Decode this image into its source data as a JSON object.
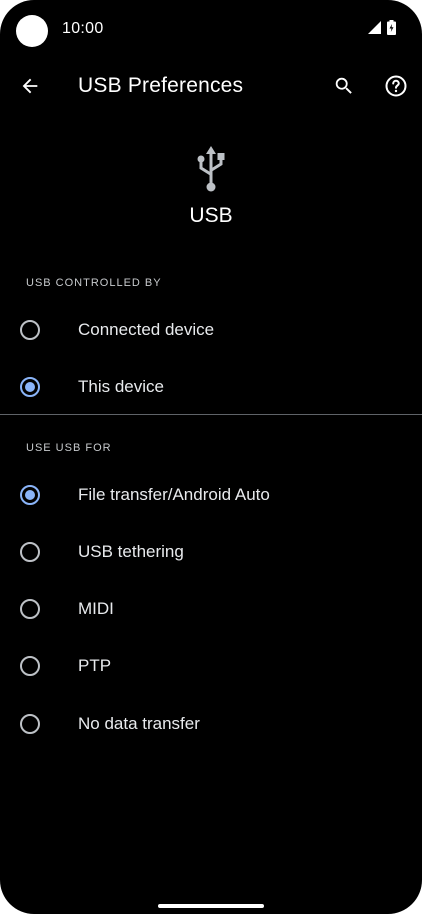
{
  "status_bar": {
    "time": "10:00",
    "icons": [
      "signal-icon",
      "battery-icon"
    ]
  },
  "app_bar": {
    "title": "USB Preferences",
    "icons": [
      "back-arrow-icon",
      "search-icon",
      "help-icon"
    ]
  },
  "header": {
    "icon": "usb-icon",
    "title": "USB"
  },
  "controlled_by": {
    "heading": "USB CONTROLLED BY",
    "options": [
      {
        "label": "Connected device",
        "checked": false
      },
      {
        "label": "This device",
        "checked": true
      }
    ]
  },
  "use_for": {
    "heading": "USE USB FOR",
    "options": [
      {
        "label": "File transfer/Android Auto",
        "checked": true
      },
      {
        "label": "USB tethering",
        "checked": false
      },
      {
        "label": "MIDI",
        "checked": false
      },
      {
        "label": "PTP",
        "checked": false
      },
      {
        "label": "No data transfer",
        "checked": false
      }
    ]
  },
  "colors": {
    "background": "#000000",
    "accent": "#8ab4f8",
    "text": "#e8eaed",
    "divider": "#5f6368"
  }
}
